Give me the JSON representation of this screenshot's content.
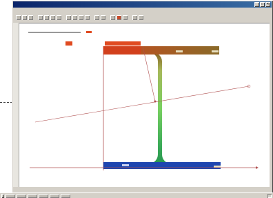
{
  "window": {
    "title": "",
    "controls": [
      "_",
      "□",
      "×"
    ]
  },
  "menu": {
    "items": [
      "",
      "",
      "",
      "",
      ""
    ]
  },
  "toolbar": {
    "buttons": 20
  },
  "drawing": {
    "colors": {
      "top_flange_left": "#e04a20",
      "top_flange_right": "#8a6a28",
      "web_top": "#8a6a28",
      "web_mid": "#78d060",
      "web_bottom": "#2a9a50",
      "bottom_flange": "#1e46b0",
      "axis": "#b05050"
    }
  },
  "status": {
    "text": ""
  },
  "taskbar": {
    "start": "",
    "clock": ""
  }
}
